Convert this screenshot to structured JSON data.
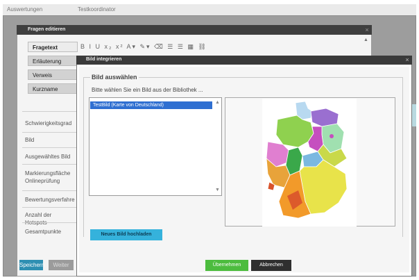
{
  "topbar": {
    "crumb_left": "Auswertungen",
    "crumb_right": "Testkoordinator"
  },
  "question_editor": {
    "title": "Fragen editieren",
    "tabs": [
      {
        "label": "Fragetext",
        "active": true
      },
      {
        "label": "Erläuterung",
        "active": false
      },
      {
        "label": "Verweis",
        "active": false
      },
      {
        "label": "Kurzname",
        "active": false
      }
    ],
    "toolbar_text": "B I U  x₂ x²  A▾ ✎▾  ⌫  ☰ ☰  ▦  ⛓",
    "fields": [
      "Schwierigkeitsgrad",
      "Bild",
      "Ausgewähltes Bild",
      "Markierungsfläche Onlineprüfung",
      "Bewertungsverfahren",
      "Anzahl der Hotspots",
      "Gesamtpunkte"
    ],
    "save_label": "Speichern",
    "next_label": "Weiter"
  },
  "dialog": {
    "title": "Bild integrieren",
    "legend": "Bild auswählen",
    "instruction": "Bitte wählen Sie ein Bild aus der Bibliothek ...",
    "list_items": [
      "TestBild (Karte von Deutschland)"
    ],
    "upload_label": "Neues Bild hochladen",
    "apply_label": "Übernehmen",
    "cancel_label": "Abbrechen"
  },
  "colors": {
    "accent": "#35b2dc",
    "apply": "#4cbc3e",
    "cancel": "#2f2f2f",
    "selection": "#2f6fd1",
    "map_states": [
      "#8fd14f",
      "#b8d9f0",
      "#9a6fd0",
      "#c54fbf",
      "#e07fd0",
      "#a0e0b0",
      "#7ab8e0",
      "#e8e34a",
      "#f29a2a",
      "#d9532b",
      "#3aa84a",
      "#c9d94a"
    ]
  }
}
